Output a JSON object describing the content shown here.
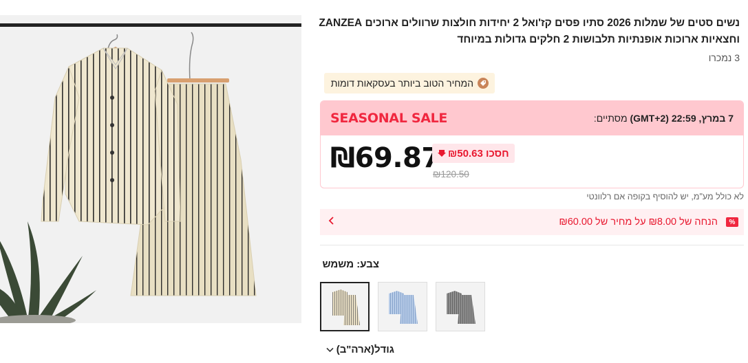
{
  "product": {
    "title": "נשים סטים של שמלות 2026 סתיו פסים קז'ואל 2 יחידות חולצות שרוולים ארוכים ZANZEA וחצאיות ארוכות אופנתיות תלבושות 2 חלקים גדולות במיוחד",
    "sold": "3 נמכרו",
    "best_price_label": "המחיר הטוב ביותר בעסקאות דומות"
  },
  "sale": {
    "banner": "SEASONAL SALE",
    "ends_prefix": "מסתיים:",
    "ends_time": "7 במרץ, 22:59 (GMT+2)",
    "price": "₪69.87",
    "save": "חסכו ₪50.63",
    "original_price": "₪120.50",
    "vat_note": "לא כולל מע\"מ, יש להוסיף בקופה אם רלוונטי"
  },
  "discount": {
    "badge": "%",
    "text": "הנחה של ₪8.00 על מחיר של ₪60.00"
  },
  "color": {
    "label": "צבע: משמש",
    "options": [
      "משמש",
      "כחול",
      "אפור"
    ]
  },
  "size": {
    "label": "גודל(ארה\"ב)"
  },
  "colors": {
    "accent": "#f0273f",
    "sale_header_bg": "#ffc8cf",
    "best_price_bg": "#fdf3df",
    "discount_bg": "#fff0f2"
  }
}
